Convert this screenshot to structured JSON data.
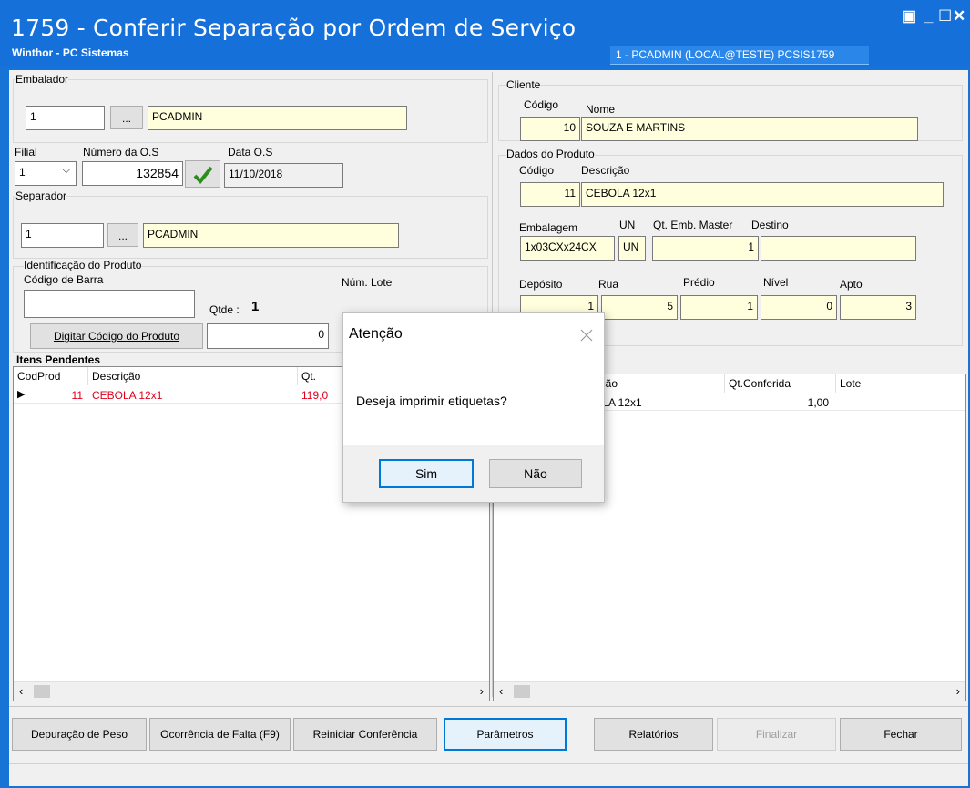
{
  "window": {
    "title": "1759 - Conferir Separação por Ordem de Serviço",
    "subtitle": "Winthor - PC Sistemas",
    "user_info": "1 - PCADMIN (LOCAL@TESTE)  PCSIS1759",
    "restore_glyph": "▣",
    "minimize_glyph": "_",
    "maximize_glyph": "☐",
    "close_glyph": "✕"
  },
  "embalador": {
    "legend": "Embalador",
    "code": "1",
    "lookup": "...",
    "name": "PCADMIN"
  },
  "filial": {
    "label": "Filial",
    "value": "1"
  },
  "os": {
    "label": "Número da  O.S",
    "value": "132854"
  },
  "data_os": {
    "label": "Data O.S",
    "value": "11/10/2018"
  },
  "separador": {
    "legend": "Separador",
    "code": "1",
    "lookup": "...",
    "name": "PCADMIN"
  },
  "identificacao": {
    "legend": "Identificação do Produto",
    "barcode_label": "Código de Barra",
    "barcode_value": "",
    "lote_label": "Núm. Lote",
    "qtde_label": "Qtde :",
    "qtde_value": "1",
    "digitar_button": "Digitar Código do Produto",
    "qty_input": "0"
  },
  "cliente": {
    "legend": "Cliente",
    "codigo_label": "Código",
    "nome_label": "Nome",
    "codigo": "10",
    "nome": "SOUZA E MARTINS"
  },
  "produto": {
    "legend": "Dados do Produto",
    "codigo_label": "Código",
    "descricao_label": "Descrição",
    "codigo": "11",
    "descricao": "CEBOLA 12x1",
    "embalagem_label": "Embalagem",
    "un_label": "UN",
    "qt_master_label": "Qt. Emb. Master",
    "destino_label": "Destino",
    "embalagem": "1x03CXx24CX",
    "un": "UN",
    "qt_master": "1",
    "destino": "",
    "deposito_label": "Depósito",
    "rua_label": "Rua",
    "predio_label": "Prédio",
    "nivel_label": "Nível",
    "apto_label": "Apto",
    "deposito": "1",
    "rua": "5",
    "predio": "1",
    "nivel": "0",
    "apto": "3"
  },
  "itens_pendentes": {
    "title": "Itens Pendentes",
    "columns": [
      "CodProd",
      "Descrição",
      "Qt."
    ],
    "rows": [
      {
        "codprod": "11",
        "descricao": "CEBOLA 12x1",
        "qt": "119,0"
      }
    ]
  },
  "conferidos": {
    "columns": [
      "rição",
      "Qt.Conferida",
      "Lote"
    ],
    "rows": [
      {
        "descricao": "OLA 12x1",
        "qt": "1,00",
        "lote": ""
      }
    ]
  },
  "dialog": {
    "title": "Atenção",
    "message": "Deseja imprimir etiquetas?",
    "yes": "Sim",
    "no": "Não"
  },
  "buttons": {
    "depuracao": "Depuração de Peso",
    "ocorrencia": "Ocorrência de Falta (F9)",
    "reiniciar": "Reiniciar Conferência",
    "parametros": "Parâmetros",
    "relatorios": "Relatórios",
    "finalizar": "Finalizar",
    "fechar": "Fechar"
  },
  "colors": {
    "title_bar": "#1570d9",
    "yellow_field": "#ffffdd",
    "pending_text": "#e0001b",
    "accent_border": "#0078d7"
  }
}
